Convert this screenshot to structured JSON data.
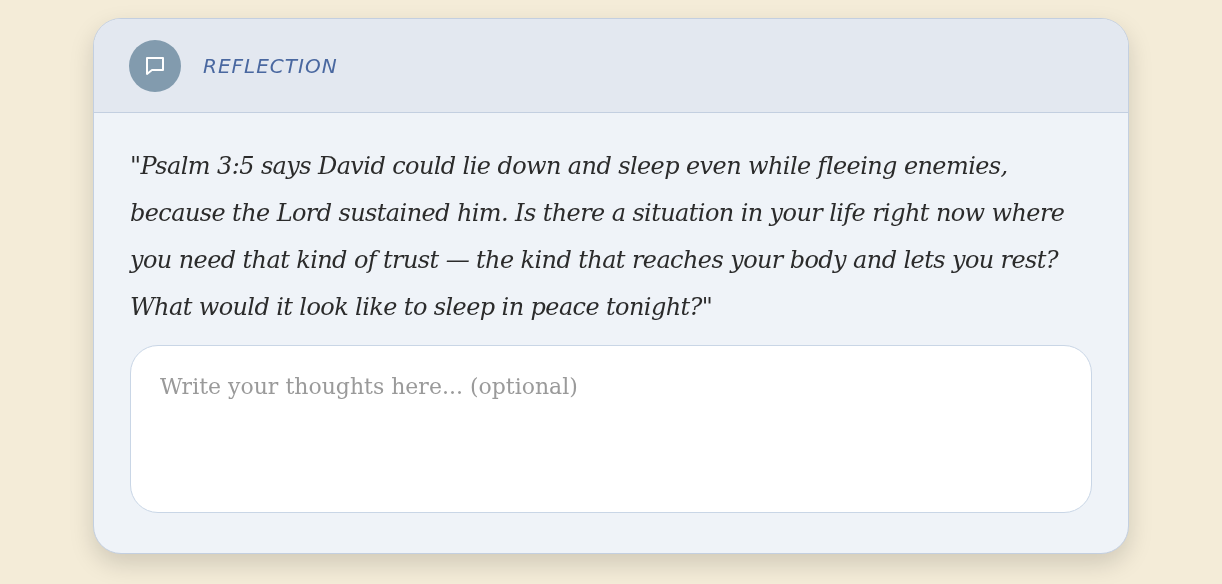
{
  "card": {
    "label": "REFLECTION",
    "prompt": "\"Psalm 3:5 says David could lie down and sleep even while fleeing enemies, because the Lord sustained him. Is there a situation in your life right now where you need that kind of trust — the kind that reaches your body and lets you rest? What would it look like to sleep in peace tonight?\"",
    "answer": {
      "placeholder": "Write your thoughts here... (optional)"
    }
  }
}
